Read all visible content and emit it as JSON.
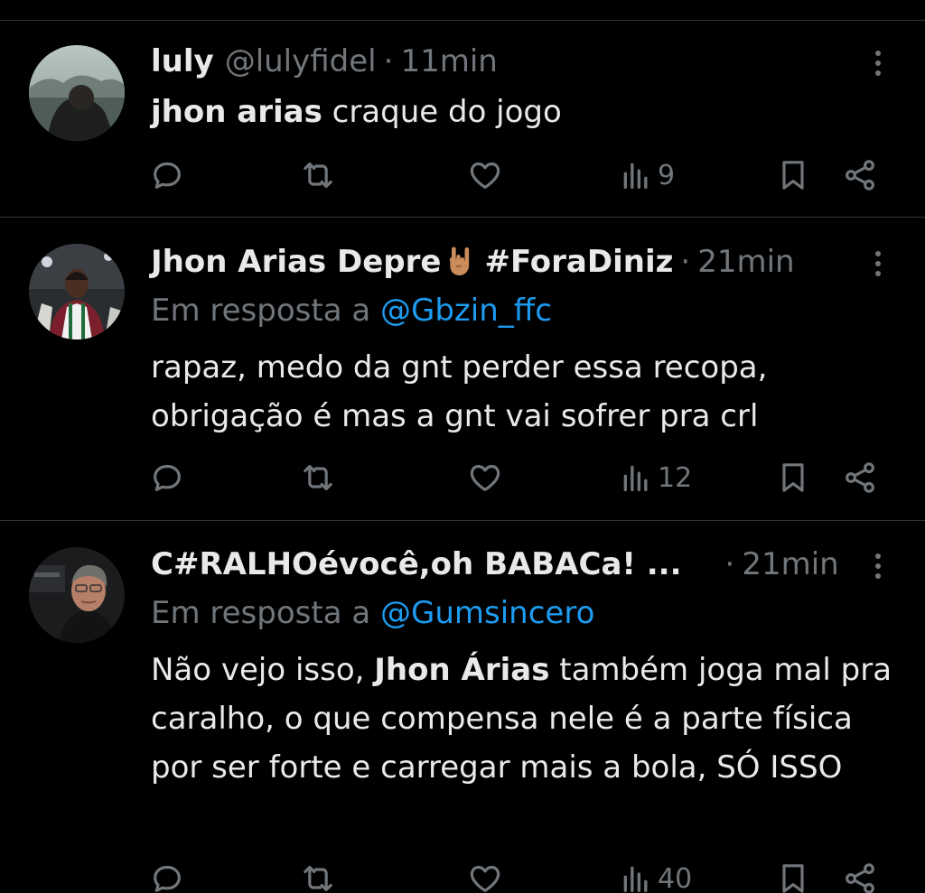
{
  "tweets": [
    {
      "name": "luly",
      "handle": "@lulyfidel",
      "dot": "·",
      "time": "11min",
      "text_bold": "jhon arias",
      "text_rest": " craque do jogo",
      "views": "9"
    },
    {
      "name": "Jhon Arias Depre",
      "name_suffix": "#ForaDiniz",
      "emoji": "rock-on-hand",
      "dot": "·",
      "time": "21min",
      "reply_prefix": "Em resposta a",
      "reply_to": "@Gbzin_ffc",
      "text": "rapaz, medo da gnt perder essa recopa, obrigação é mas a gnt vai sofrer pra crl",
      "views": "12"
    },
    {
      "name": "C#RALHOévocê,oh BABACa! ...",
      "dot": "·",
      "time": "21min",
      "reply_prefix": "Em resposta a",
      "reply_to": "@Gumsincero",
      "text_pre": "Não vejo isso, ",
      "text_bold": "Jhon Árias",
      "text_post": " também joga mal pra caralho, o que compensa nele é a parte física por ser forte e carregar mais a bola, SÓ ISSO",
      "views": "40"
    }
  ],
  "icons": {
    "reply": "reply-icon",
    "retweet": "retweet-icon",
    "like": "like-icon",
    "views": "views-icon",
    "bookmark": "bookmark-icon",
    "share": "share-icon",
    "more": "more-options-icon"
  },
  "colors": {
    "background": "#000000",
    "text": "#e7e9ea",
    "muted": "#71767b",
    "link": "#1d9bf0",
    "divider": "#2f3336"
  }
}
